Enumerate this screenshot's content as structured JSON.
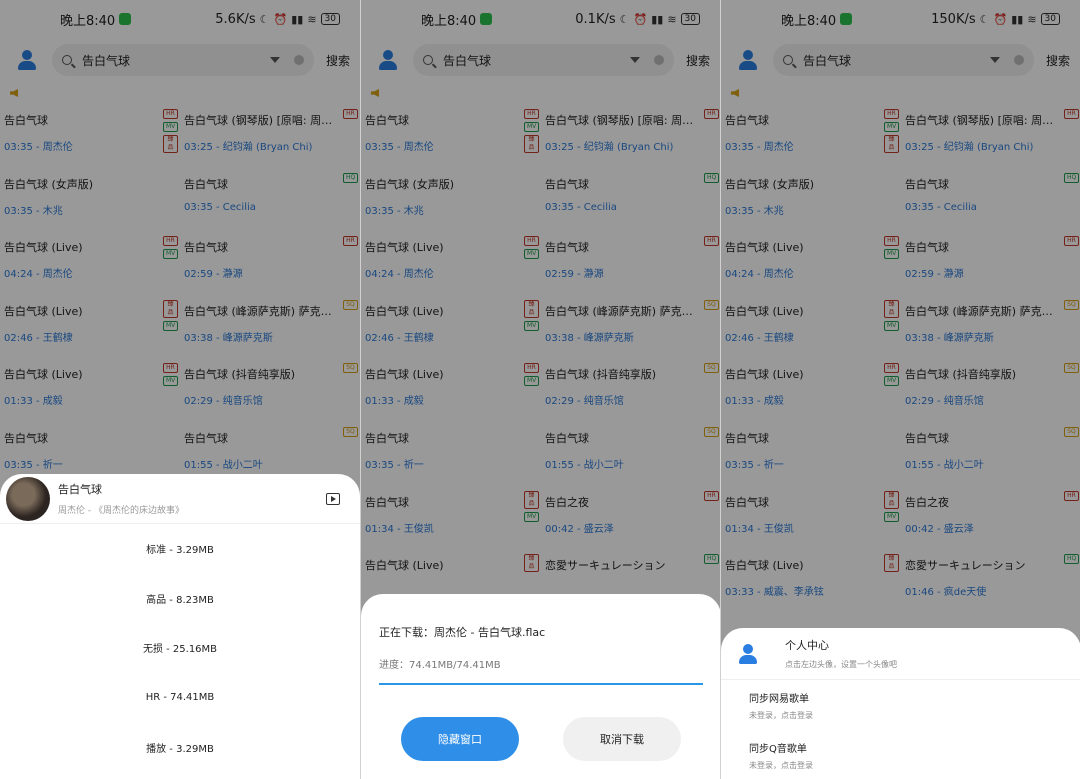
{
  "screens": [
    {
      "status": {
        "time": "晚上8:40",
        "speed": "5.6K/s",
        "battery": "30"
      },
      "search": {
        "query": "告白气球",
        "button": "搜索"
      },
      "songs": [
        {
          "title": "告白气球",
          "meta": "03:35 - 周杰伦",
          "badges": [
            "HR",
            "MV",
            "臻品"
          ]
        },
        {
          "title": "告白气球 (钢琴版) [原唱: 周杰伦]",
          "meta": "03:25 - 纪钧瀚 (Bryan Chi)",
          "badges": [
            "HR"
          ]
        },
        {
          "title": "告白气球 (女声版)",
          "meta": "03:35 - 木兆",
          "badges": []
        },
        {
          "title": "告白气球",
          "meta": "03:35 - Cecilia",
          "badges": [
            "HQ"
          ]
        },
        {
          "title": "告白气球 (Live)",
          "meta": "04:24 - 周杰伦",
          "badges": [
            "HR",
            "MV"
          ]
        },
        {
          "title": "告白气球",
          "meta": "02:59 - 瀞源",
          "badges": [
            "HR"
          ]
        },
        {
          "title": "告白气球 (Live)",
          "meta": "02:46 - 王鹤棣",
          "badges": [
            "臻品",
            "MV"
          ]
        },
        {
          "title": "告白气球 (峰源萨克斯) 萨克斯版",
          "meta": "03:38 - 峰源萨克斯",
          "badges": [
            "SQ"
          ]
        },
        {
          "title": "告白气球 (Live)",
          "meta": "01:33 - 成毅",
          "badges": [
            "HR",
            "MV"
          ]
        },
        {
          "title": "告白气球 (抖音纯享版)",
          "meta": "02:29 - 纯音乐馆",
          "badges": [
            "SQ"
          ]
        },
        {
          "title": "告白气球",
          "meta": "03:35 - 祈一",
          "badges": []
        },
        {
          "title": "告白气球",
          "meta": "01:55 - 战小二叶",
          "badges": [
            "SQ"
          ]
        }
      ],
      "sheet": {
        "song_title": "告白气球",
        "song_sub": "周杰伦 - 《周杰伦的床边故事》",
        "qualities": [
          "标准 - 3.29MB",
          "高品 - 8.23MB",
          "无损 - 25.16MB",
          "HR - 74.41MB",
          "播放 - 3.29MB"
        ]
      }
    },
    {
      "status": {
        "time": "晚上8:40",
        "speed": "0.1K/s",
        "battery": "30"
      },
      "search": {
        "query": "告白气球",
        "button": "搜索"
      },
      "songs": [
        {
          "title": "告白气球",
          "meta": "03:35 - 周杰伦",
          "badges": [
            "HR",
            "MV",
            "臻品"
          ]
        },
        {
          "title": "告白气球 (钢琴版) [原唱: 周杰伦]",
          "meta": "03:25 - 纪钧瀚 (Bryan Chi)",
          "badges": [
            "HR"
          ]
        },
        {
          "title": "告白气球 (女声版)",
          "meta": "03:35 - 木兆",
          "badges": []
        },
        {
          "title": "告白气球",
          "meta": "03:35 - Cecilia",
          "badges": [
            "HQ"
          ]
        },
        {
          "title": "告白气球 (Live)",
          "meta": "04:24 - 周杰伦",
          "badges": [
            "HR",
            "MV"
          ]
        },
        {
          "title": "告白气球",
          "meta": "02:59 - 瀞源",
          "badges": [
            "HR"
          ]
        },
        {
          "title": "告白气球 (Live)",
          "meta": "02:46 - 王鹤棣",
          "badges": [
            "臻品",
            "MV"
          ]
        },
        {
          "title": "告白气球 (峰源萨克斯) 萨克斯版",
          "meta": "03:38 - 峰源萨克斯",
          "badges": [
            "SQ"
          ]
        },
        {
          "title": "告白气球 (Live)",
          "meta": "01:33 - 成毅",
          "badges": [
            "HR",
            "MV"
          ]
        },
        {
          "title": "告白气球 (抖音纯享版)",
          "meta": "02:29 - 纯音乐馆",
          "badges": [
            "SQ"
          ]
        },
        {
          "title": "告白气球",
          "meta": "03:35 - 祈一",
          "badges": []
        },
        {
          "title": "告白气球",
          "meta": "01:55 - 战小二叶",
          "badges": [
            "SQ"
          ]
        },
        {
          "title": "告白气球",
          "meta": "01:34 - 王俊凯",
          "badges": [
            "臻品",
            "MV"
          ]
        },
        {
          "title": "告白之夜",
          "meta": "00:42 - 盛云泽",
          "badges": [
            "HR"
          ]
        },
        {
          "title": "告白气球 (Live)",
          "meta": "",
          "badges": [
            "臻品"
          ]
        },
        {
          "title": "恋愛サーキュレーション",
          "meta": "",
          "badges": [
            "HQ"
          ]
        }
      ],
      "download": {
        "title": "正在下载：周杰伦 - 告白气球.flac",
        "progress": "进度：74.41MB/74.41MB",
        "progress_fraction": 1.0,
        "hide_button": "隐藏窗口",
        "cancel_button": "取消下载"
      }
    },
    {
      "status": {
        "time": "晚上8:40",
        "speed": "150K/s",
        "battery": "30"
      },
      "search": {
        "query": "告白气球",
        "button": "搜索"
      },
      "songs": [
        {
          "title": "告白气球",
          "meta": "03:35 - 周杰伦",
          "badges": [
            "HR",
            "MV",
            "臻品"
          ]
        },
        {
          "title": "告白气球 (钢琴版) [原唱: 周杰伦]",
          "meta": "03:25 - 纪钧瀚 (Bryan Chi)",
          "badges": [
            "HR"
          ]
        },
        {
          "title": "告白气球 (女声版)",
          "meta": "03:35 - 木兆",
          "badges": []
        },
        {
          "title": "告白气球",
          "meta": "03:35 - Cecilia",
          "badges": [
            "HQ"
          ]
        },
        {
          "title": "告白气球 (Live)",
          "meta": "04:24 - 周杰伦",
          "badges": [
            "HR",
            "MV"
          ]
        },
        {
          "title": "告白气球",
          "meta": "02:59 - 瀞源",
          "badges": [
            "HR"
          ]
        },
        {
          "title": "告白气球 (Live)",
          "meta": "02:46 - 王鹤棣",
          "badges": [
            "臻品",
            "MV"
          ]
        },
        {
          "title": "告白气球 (峰源萨克斯) 萨克斯版",
          "meta": "03:38 - 峰源萨克斯",
          "badges": [
            "SQ"
          ]
        },
        {
          "title": "告白气球 (Live)",
          "meta": "01:33 - 成毅",
          "badges": [
            "HR",
            "MV"
          ]
        },
        {
          "title": "告白气球 (抖音纯享版)",
          "meta": "02:29 - 纯音乐馆",
          "badges": [
            "SQ"
          ]
        },
        {
          "title": "告白气球",
          "meta": "03:35 - 祈一",
          "badges": []
        },
        {
          "title": "告白气球",
          "meta": "01:55 - 战小二叶",
          "badges": [
            "SQ"
          ]
        },
        {
          "title": "告白气球",
          "meta": "01:34 - 王俊凯",
          "badges": [
            "臻品",
            "MV"
          ]
        },
        {
          "title": "告白之夜",
          "meta": "00:42 - 盛云泽",
          "badges": [
            "HR"
          ]
        },
        {
          "title": "告白气球 (Live)",
          "meta": "03:33 - 威震、李承铉",
          "badges": [
            "臻品"
          ]
        },
        {
          "title": "恋愛サーキュレーション",
          "meta": "01:46 - 疯de天使",
          "badges": [
            "HQ"
          ]
        }
      ],
      "personal": {
        "title": "个人中心",
        "subtitle": "点击左边头像，设置一个头像吧",
        "items": [
          {
            "title": "同步网易歌单",
            "sub": "未登录，点击登录"
          },
          {
            "title": "同步Q音歌单",
            "sub": "未登录，点击登录"
          }
        ]
      }
    }
  ]
}
